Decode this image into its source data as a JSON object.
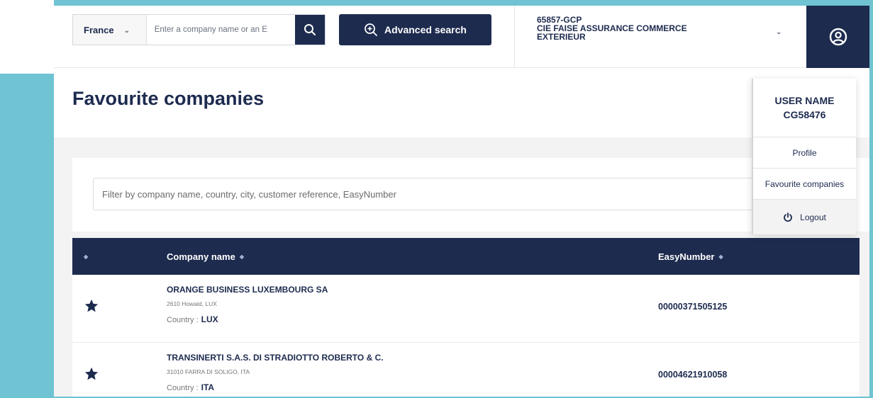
{
  "search": {
    "country": "France",
    "placeholder": "Enter a company name or an E",
    "advanced_label": "Advanced search"
  },
  "company": {
    "code": "65857-GCP",
    "name_line1": "CIE FAISE ASSURANCE COMMERCE",
    "name_line2": "EXTERIEUR"
  },
  "page": {
    "title": "Favourite companies"
  },
  "filter": {
    "placeholder": "Filter by company name, country, city, customer reference, EasyNumber"
  },
  "table": {
    "headers": {
      "company_name": "Company name",
      "easynumber": "EasyNumber"
    },
    "rows": [
      {
        "name": "ORANGE BUSINESS LUXEMBOURG SA",
        "address": "2610 Howald, LUX",
        "country_label": "Country :",
        "country": "LUX",
        "easynumber": "00000371505125"
      },
      {
        "name": "TRANSINERTI S.A.S. DI STRADIOTTO ROBERTO & C.",
        "address": "31010 FARRA DI SOLIGO, ITA",
        "country_label": "Country :",
        "country": "ITA",
        "easynumber": "00004621910058"
      }
    ]
  },
  "user_menu": {
    "user_name": "USER NAME",
    "user_id": "CG58476",
    "profile": "Profile",
    "favourites": "Favourite companies",
    "logout": "Logout"
  },
  "colors": {
    "navy": "#1d2b4f",
    "teal_frame": "#6fc3d3",
    "page_bg": "#f3f3f3"
  },
  "icons": [
    "search-icon",
    "zoom-plus-icon",
    "chevron-down-icon",
    "user-circle-icon",
    "star-icon",
    "power-icon",
    "sort-icon"
  ]
}
